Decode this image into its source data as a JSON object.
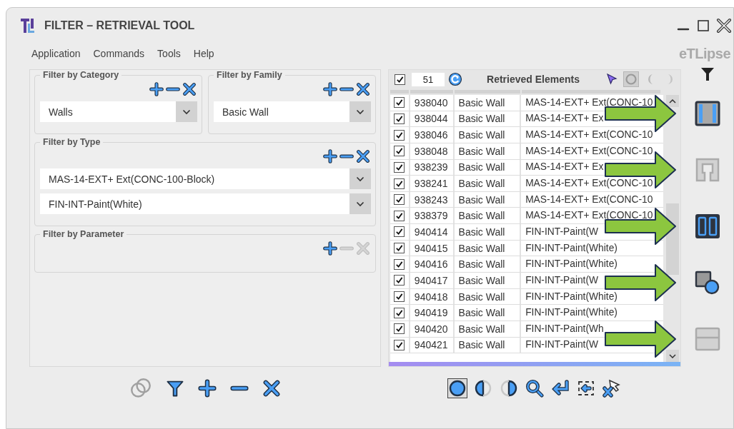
{
  "window": {
    "title": "FILTER – RETRIEVAL TOOL"
  },
  "logo": "eTLipse",
  "menu": [
    "Application",
    "Commands",
    "Tools",
    "Help"
  ],
  "filters": [
    {
      "title": "Filter by Category",
      "actions": [
        {
          "kind": "add",
          "disabled": false
        },
        {
          "kind": "remove",
          "disabled": false
        },
        {
          "kind": "clear",
          "disabled": false
        }
      ],
      "dropdowns": [
        "Walls"
      ]
    },
    {
      "title": "Filter by Family",
      "actions": [
        {
          "kind": "add",
          "disabled": false
        },
        {
          "kind": "remove",
          "disabled": false
        },
        {
          "kind": "clear",
          "disabled": false
        }
      ],
      "dropdowns": [
        "Basic Wall"
      ]
    },
    {
      "title": "Filter by Type",
      "actions": [
        {
          "kind": "add",
          "disabled": false
        },
        {
          "kind": "remove",
          "disabled": false
        },
        {
          "kind": "clear",
          "disabled": false
        }
      ],
      "dropdowns": [
        "MAS-14-EXT+ Ext(CONC-100-Block)",
        "FIN-INT-Paint(White)"
      ]
    },
    {
      "title": "Filter by Parameter",
      "actions": [
        {
          "kind": "add",
          "disabled": false
        },
        {
          "kind": "remove",
          "disabled": true
        },
        {
          "kind": "clear",
          "disabled": true
        }
      ]
    }
  ],
  "results": {
    "all_checked": true,
    "count": "51",
    "title": "Retrieved Elements",
    "progress": {
      "level": 1
    },
    "view_buttons": [
      {
        "kind": "pick",
        "selected": false
      },
      {
        "kind": "ring",
        "selected": true
      },
      {
        "kind": "left",
        "selected": false
      },
      {
        "kind": "right",
        "selected": false
      }
    ],
    "rows": [
      {
        "checked": true,
        "id": "938040",
        "family": "Basic Wall",
        "type": "MAS-14-EXT+ Ext(CONC-10"
      },
      {
        "checked": true,
        "id": "938044",
        "family": "Basic Wall",
        "type": "MAS-14-EXT+ Ex"
      },
      {
        "checked": true,
        "id": "938046",
        "family": "Basic Wall",
        "type": "MAS-14-EXT+ Ext(CONC-10"
      },
      {
        "checked": true,
        "id": "938048",
        "family": "Basic Wall",
        "type": "MAS-14-EXT+ Ext(CONC-10"
      },
      {
        "checked": true,
        "id": "938239",
        "family": "Basic Wall",
        "type": "MAS-14-EXT+ Ex"
      },
      {
        "checked": true,
        "id": "938241",
        "family": "Basic Wall",
        "type": "MAS-14-EXT+ Ext(CONC-10"
      },
      {
        "checked": true,
        "id": "938243",
        "family": "Basic Wall",
        "type": "MAS-14-EXT+ Ext(CONC-10"
      },
      {
        "checked": true,
        "id": "938379",
        "family": "Basic Wall",
        "type": "MAS-14-EXT+ Ext(CONC-10"
      },
      {
        "checked": true,
        "id": "940414",
        "family": "Basic Wall",
        "type": "FIN-INT-Paint(W"
      },
      {
        "checked": true,
        "id": "940415",
        "family": "Basic Wall",
        "type": "FIN-INT-Paint(White)"
      },
      {
        "checked": true,
        "id": "940416",
        "family": "Basic Wall",
        "type": "FIN-INT-Paint(White)"
      },
      {
        "checked": true,
        "id": "940417",
        "family": "Basic Wall",
        "type": "FIN-INT-Paint(W"
      },
      {
        "checked": true,
        "id": "940418",
        "family": "Basic Wall",
        "type": "FIN-INT-Paint(White)"
      },
      {
        "checked": true,
        "id": "940419",
        "family": "Basic Wall",
        "type": "FIN-INT-Paint(White)"
      },
      {
        "checked": true,
        "id": "940420",
        "family": "Basic Wall",
        "type": "FIN-INT-Paint(Wh"
      },
      {
        "checked": true,
        "id": "940421",
        "family": "Basic Wall",
        "type": "FIN-INT-Paint(W"
      }
    ]
  },
  "side_tools": [
    {
      "kind": "columns",
      "disabled": false,
      "highlighted": true
    },
    {
      "kind": "frame",
      "disabled": true,
      "highlighted": true
    },
    {
      "kind": "split",
      "disabled": false,
      "highlighted": true
    },
    {
      "kind": "shapes",
      "disabled": false,
      "highlighted": true
    },
    {
      "kind": "rows",
      "disabled": true,
      "highlighted": true
    }
  ],
  "bottom_left_tools": [
    {
      "kind": "link",
      "disabled": true
    },
    {
      "kind": "filter",
      "disabled": false
    },
    {
      "kind": "add",
      "disabled": false
    },
    {
      "kind": "remove",
      "disabled": false
    },
    {
      "kind": "clear",
      "disabled": false
    }
  ],
  "bottom_right_tools": [
    {
      "kind": "fill",
      "selected": true
    },
    {
      "kind": "half-left",
      "selected": false
    },
    {
      "kind": "half-right",
      "selected": false
    },
    {
      "kind": "search",
      "selected": false
    },
    {
      "kind": "enter",
      "selected": false
    },
    {
      "kind": "select-in",
      "selected": false
    },
    {
      "kind": "deselect",
      "selected": false
    }
  ]
}
